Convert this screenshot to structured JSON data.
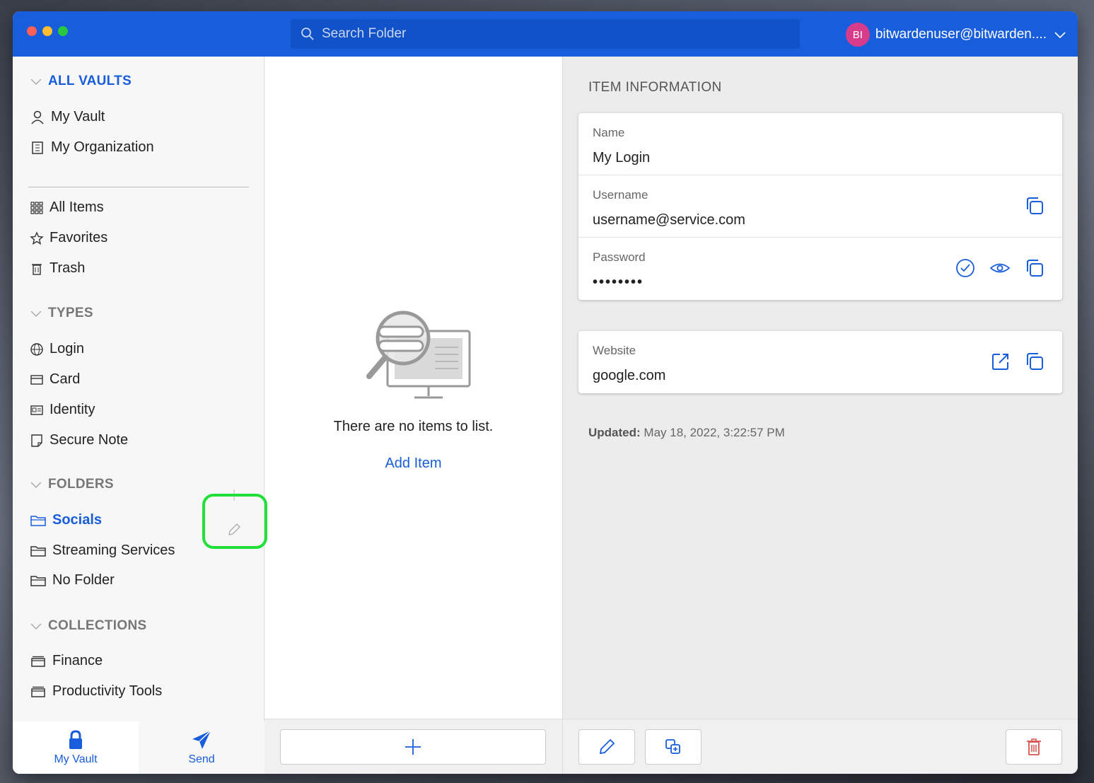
{
  "search": {
    "placeholder": "Search Folder"
  },
  "account": {
    "initials": "BI",
    "email": "bitwardenuser@bitwarden...."
  },
  "sidebar": {
    "all_vaults": "ALL VAULTS",
    "vaults": [
      "My Vault",
      "My Organization"
    ],
    "filters": [
      "All Items",
      "Favorites",
      "Trash"
    ],
    "types_head": "TYPES",
    "types": [
      "Login",
      "Card",
      "Identity",
      "Secure Note"
    ],
    "folders_head": "FOLDERS",
    "folders": [
      "Socials",
      "Streaming Services",
      "No Folder"
    ],
    "collections_head": "COLLECTIONS",
    "collections": [
      "Finance",
      "Productivity Tools"
    ]
  },
  "bottom_tabs": [
    "My Vault",
    "Send"
  ],
  "list": {
    "empty_text": "There are no items to list.",
    "add_item": "Add Item"
  },
  "item": {
    "section_label": "ITEM INFORMATION",
    "name_label": "Name",
    "name_value": "My Login",
    "username_label": "Username",
    "username_value": "username@service.com",
    "password_label": "Password",
    "password_value": "••••••••",
    "website_label": "Website",
    "website_value": "google.com",
    "updated_label": "Updated:",
    "updated_value": "May 18, 2022, 3:22:57 PM"
  },
  "colors": {
    "brand": "#175ddc",
    "highlight": "#22e03a",
    "danger": "#d9534f"
  }
}
